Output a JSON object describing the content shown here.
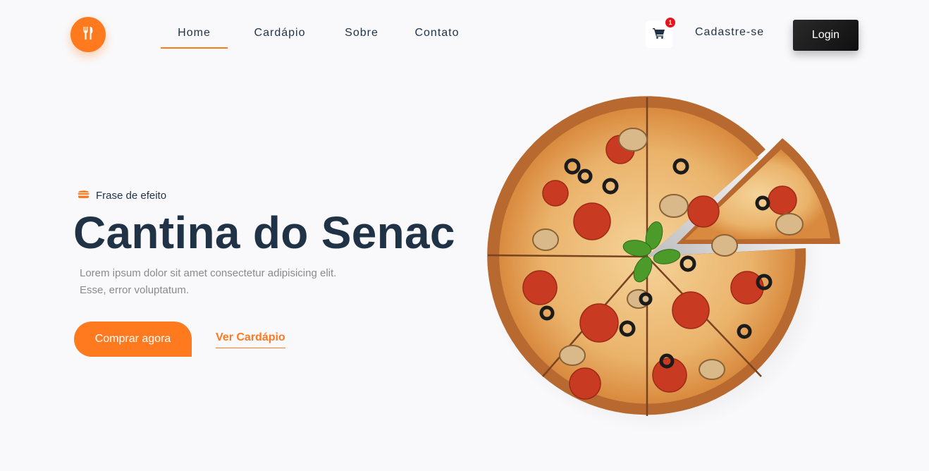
{
  "brand": {
    "logo_icon": "utensils-icon",
    "accent_color": "#ff7a1f"
  },
  "nav": {
    "items": [
      {
        "label": "Home",
        "active": true
      },
      {
        "label": "Cardápio",
        "active": false
      },
      {
        "label": "Sobre",
        "active": false
      },
      {
        "label": "Contato",
        "active": false
      }
    ]
  },
  "header": {
    "cart_icon": "shopping-cart-icon",
    "cart_count": "1",
    "signup_label": "Cadastre-se",
    "login_label": "Login"
  },
  "hero": {
    "tagline_icon": "hamburger-icon",
    "tagline": "Frase de efeito",
    "title": "Cantina do Senac",
    "description": "Lorem ipsum dolor sit amet consectetur adipisicing elit. Esse, error voluptatum.",
    "primary_button": "Comprar agora",
    "secondary_link": "Ver Cardápio",
    "image": "pizza-image"
  }
}
